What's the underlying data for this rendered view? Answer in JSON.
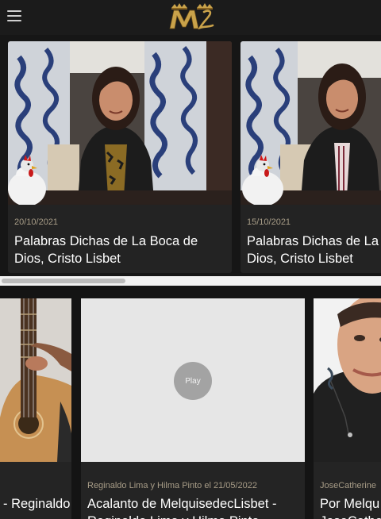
{
  "header": {
    "menu_icon": "hamburger-menu-icon",
    "logo_icon": "crowned-ml-logo-icon",
    "logo_colors": {
      "gold": "#c9a24a",
      "dark_gold": "#8a6420"
    }
  },
  "row1": {
    "cards": [
      {
        "date": "20/10/2021",
        "title_line1": "Palabras Dichas de La Boca de",
        "title_line2": "Dios, Cristo Lisbet"
      },
      {
        "date": "15/10/2021",
        "title_line1": "Palabras Dichas de La Boca de",
        "title_line2": "Dios, Cristo Lisbet"
      }
    ]
  },
  "row2": {
    "cards": [
      {
        "title_line1": "- Reginaldo"
      },
      {
        "meta": "Reginaldo Lima y Hilma Pinto el 21/05/2022",
        "title_line1": "Acalanto de MelquisedecLisbet -",
        "title_line2": "Reginaldo Lima y Hilma Pinto",
        "play_label": "Play"
      },
      {
        "meta": "JoseCatherine",
        "title_line1": "Por Melqu",
        "title_line2": "JoseCathe"
      }
    ]
  },
  "colors": {
    "accent_text": "#a79c87",
    "background": "#191919",
    "card": "#232323"
  }
}
